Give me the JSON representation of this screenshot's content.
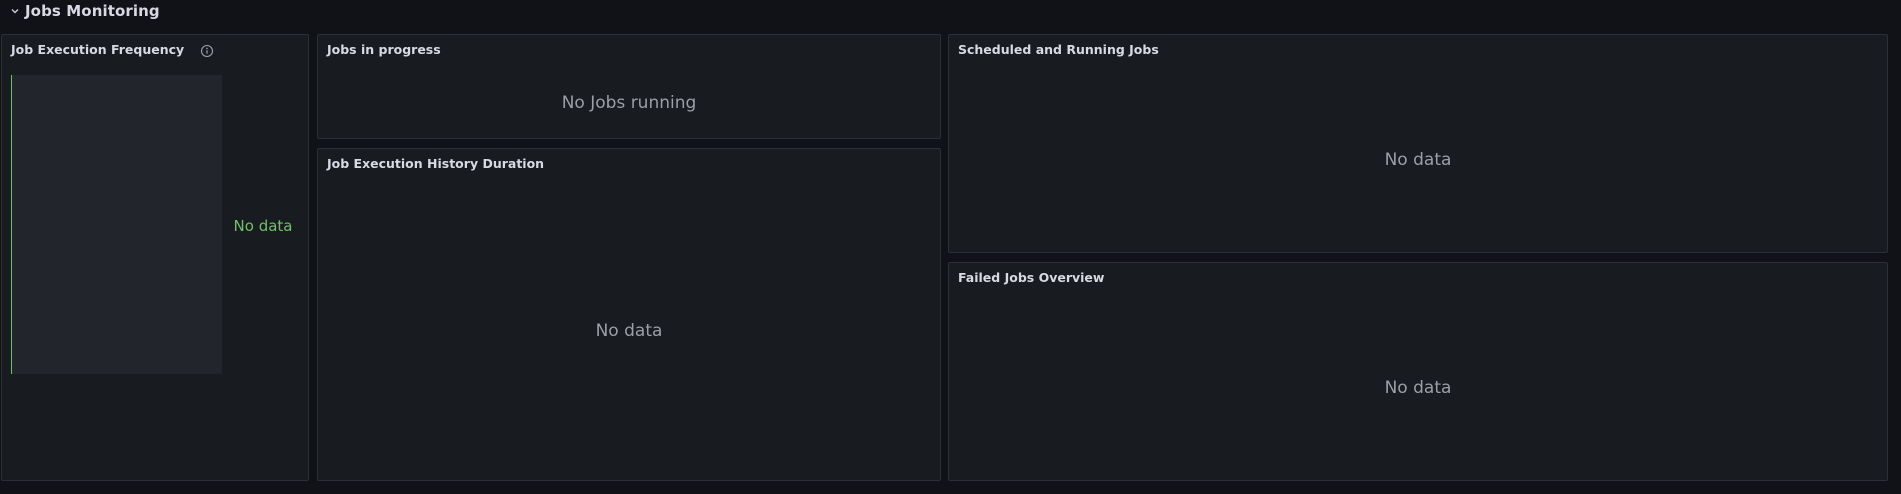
{
  "row": {
    "title": "Jobs Monitoring"
  },
  "panels": {
    "frequency": {
      "title": "Job Execution Frequency",
      "message": "No data",
      "message_color": "#73bf69"
    },
    "in_progress": {
      "title": "Jobs in progress",
      "message": "No Jobs running"
    },
    "history": {
      "title": "Job Execution History Duration",
      "message": "No data"
    },
    "scheduled": {
      "title": "Scheduled and Running Jobs",
      "message": "No data"
    },
    "failed": {
      "title": "Failed Jobs Overview",
      "message": "No data"
    }
  },
  "icons": {
    "row_toggle": "chevron-down-icon",
    "panel_info": "info-icon"
  },
  "colors": {
    "background": "#111217",
    "panel": "#181b1f",
    "border": "#2c2f36",
    "accent_green": "#73bf69"
  }
}
